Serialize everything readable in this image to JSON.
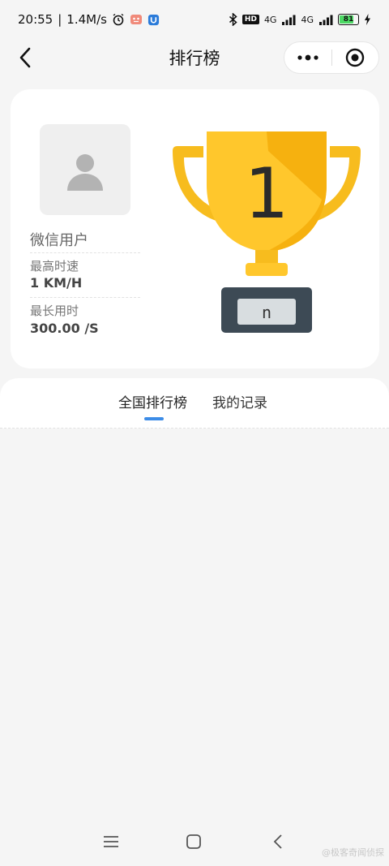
{
  "status_bar": {
    "time": "20:55",
    "speed": "1.4M/s",
    "network_1": "4G",
    "network_2": "4G",
    "hd": "HD",
    "battery": "81"
  },
  "nav": {
    "title": "排行榜"
  },
  "profile": {
    "name": "微信用户",
    "max_speed_label": "最高时速",
    "max_speed_value": "1 KM/H",
    "max_time_label": "最长用时",
    "max_time_value": "300.00 /S"
  },
  "trophy": {
    "rank": "1",
    "plaque": "n"
  },
  "tabs": [
    {
      "label": "全国排行榜",
      "active": true
    },
    {
      "label": "我的记录",
      "active": false
    }
  ],
  "colors": {
    "accent": "#3c8ce7",
    "trophy_gold": "#f7bc1e",
    "trophy_light": "#ffd447",
    "plaque_dark": "#3d4a55",
    "battery_green": "#4cd964"
  },
  "battery_level": 0.81,
  "watermark": "@极客奇闻侦探"
}
